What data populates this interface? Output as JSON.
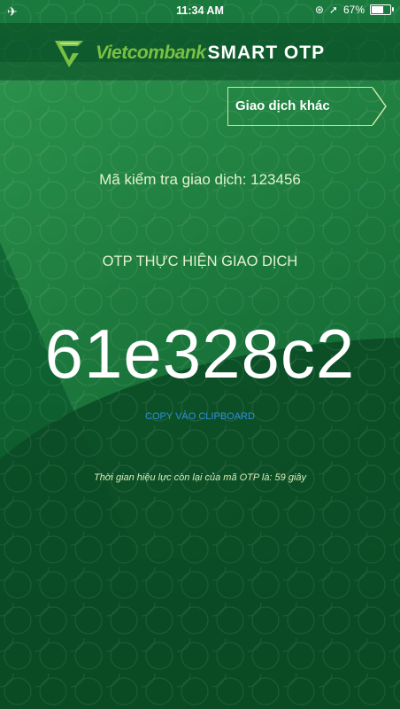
{
  "status_bar": {
    "time": "11:34 AM",
    "battery": "67%",
    "battery_level": 0.67
  },
  "header": {
    "brand_name": "Vietcombank",
    "product_name": "SMART OTP",
    "brand_color": "#7ac043"
  },
  "actions": {
    "other_transaction_label": "Giao dịch khác"
  },
  "transaction": {
    "check_code_text": "Mã kiểm tra giao dịch: 123456",
    "otp_title": "OTP THỰC HIỆN GIAO DỊCH",
    "otp_code": "61e328c2",
    "copy_label": "COPY VÀO CLIPBOARD",
    "validity_text": "Thời gian hiệu lực còn lại của mã OTP là: 59 giây"
  },
  "colors": {
    "background_green": "#0f6432",
    "link_blue": "#2c8fe0"
  },
  "icons": {
    "airplane": "airplane-icon",
    "location": "location-icon",
    "lock_rotation": "orientation-lock-icon",
    "battery": "battery-icon",
    "logo": "vietcombank-logo-icon"
  }
}
